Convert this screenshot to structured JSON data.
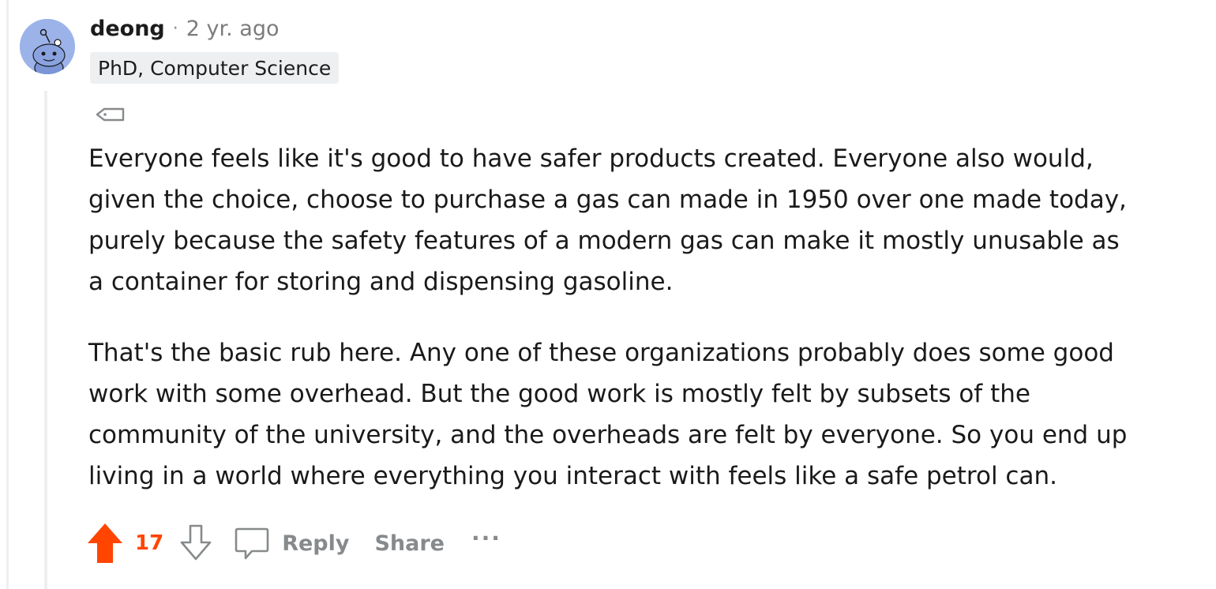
{
  "comment": {
    "username": "deong",
    "separator": "·",
    "timestamp": "2 yr. ago",
    "flair": "PhD, Computer Science",
    "paragraphs": [
      [
        "Everyone feels like it's good to have safer products created. Everyone also would,",
        "given the choice, choose to purchase a gas can made in 1950 over one made today,",
        "purely because the safety features of a modern gas can make it mostly unusable as",
        "a container for storing and dispensing gasoline."
      ],
      [
        "That's the basic rub here. Any one of these organizations probably does some good",
        "work with some overhead. But the good work is mostly felt by subsets of the",
        "community of the university, and the overheads are felt by everyone. So you end up",
        "living in a world where everything you interact with feels like a safe petrol can."
      ]
    ]
  },
  "actions": {
    "score": "17",
    "reply_label": "Reply",
    "share_label": "Share",
    "more_label": "···"
  },
  "icons": {
    "avatar": "snoo-avatar-icon",
    "award": "award-tag-icon",
    "upvote": "upvote-arrow-icon",
    "downvote": "downvote-arrow-icon",
    "reply": "comment-bubble-icon"
  },
  "colors": {
    "upvote_active": "#ff4500",
    "muted": "#878a8c",
    "avatar_bg": "#9cb3ea",
    "thread_line": "#edeff1"
  }
}
